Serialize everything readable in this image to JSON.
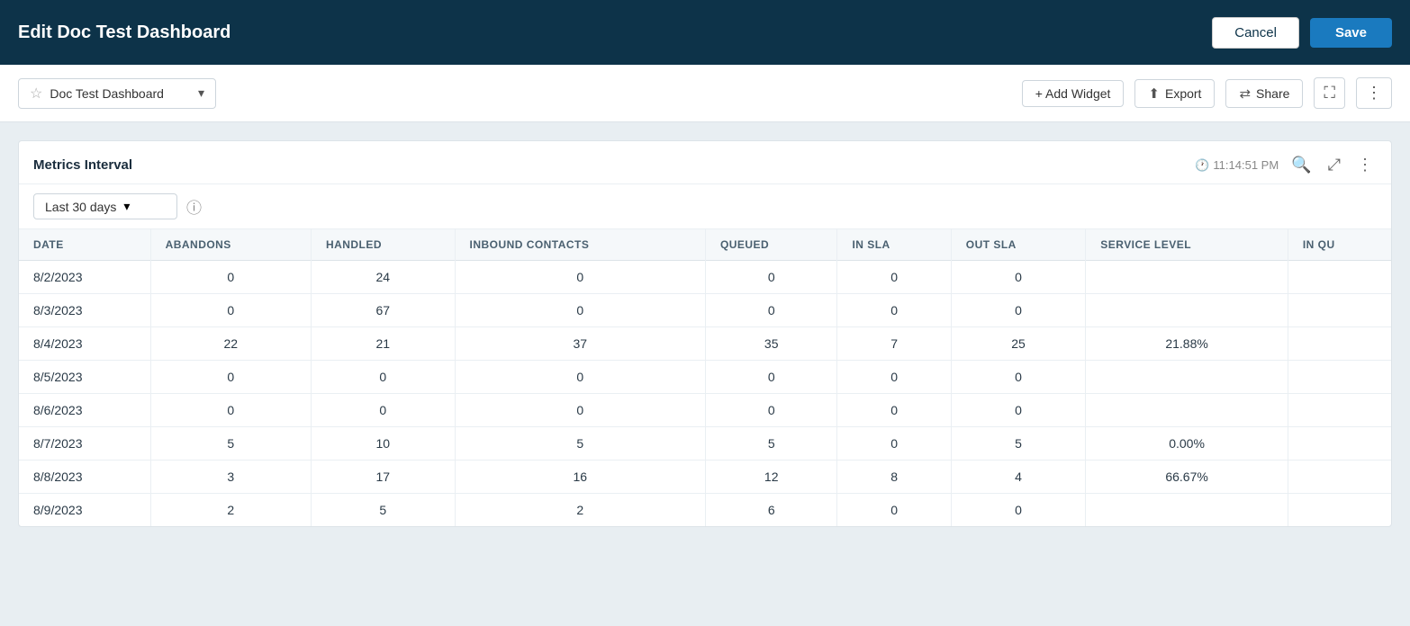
{
  "header": {
    "title": "Edit Doc Test Dashboard",
    "cancel_label": "Cancel",
    "save_label": "Save"
  },
  "toolbar": {
    "dashboard_name": "Doc Test Dashboard",
    "add_widget_label": "+ Add Widget",
    "export_label": "Export",
    "share_label": "Share"
  },
  "widget": {
    "title": "Metrics Interval",
    "timestamp": "11:14:51 PM",
    "filter_label": "Last 30 days",
    "columns": [
      "DATE",
      "ABANDONS",
      "HANDLED",
      "INBOUND CONTACTS",
      "QUEUED",
      "IN SLA",
      "OUT SLA",
      "SERVICE LEVEL",
      "IN QU"
    ],
    "rows": [
      {
        "date": "8/2/2023",
        "abandons": "0",
        "handled": "24",
        "inbound": "0",
        "queued": "0",
        "in_sla": "0",
        "out_sla": "0",
        "service_level": "",
        "in_qu": ""
      },
      {
        "date": "8/3/2023",
        "abandons": "0",
        "handled": "67",
        "inbound": "0",
        "queued": "0",
        "in_sla": "0",
        "out_sla": "0",
        "service_level": "",
        "in_qu": ""
      },
      {
        "date": "8/4/2023",
        "abandons": "22",
        "handled": "21",
        "inbound": "37",
        "queued": "35",
        "in_sla": "7",
        "out_sla": "25",
        "service_level": "21.88%",
        "in_qu": ""
      },
      {
        "date": "8/5/2023",
        "abandons": "0",
        "handled": "0",
        "inbound": "0",
        "queued": "0",
        "in_sla": "0",
        "out_sla": "0",
        "service_level": "",
        "in_qu": ""
      },
      {
        "date": "8/6/2023",
        "abandons": "0",
        "handled": "0",
        "inbound": "0",
        "queued": "0",
        "in_sla": "0",
        "out_sla": "0",
        "service_level": "",
        "in_qu": ""
      },
      {
        "date": "8/7/2023",
        "abandons": "5",
        "handled": "10",
        "inbound": "5",
        "queued": "5",
        "in_sla": "0",
        "out_sla": "5",
        "service_level": "0.00%",
        "in_qu": ""
      },
      {
        "date": "8/8/2023",
        "abandons": "3",
        "handled": "17",
        "inbound": "16",
        "queued": "12",
        "in_sla": "8",
        "out_sla": "4",
        "service_level": "66.67%",
        "in_qu": ""
      },
      {
        "date": "8/9/2023",
        "abandons": "2",
        "handled": "5",
        "inbound": "2",
        "queued": "6",
        "in_sla": "0",
        "out_sla": "0",
        "service_level": "",
        "in_qu": ""
      }
    ]
  },
  "colors": {
    "header_bg": "#0d3349",
    "header_text": "#ffffff",
    "save_bg": "#1a7abf",
    "table_header_bg": "#f5f8fa"
  }
}
